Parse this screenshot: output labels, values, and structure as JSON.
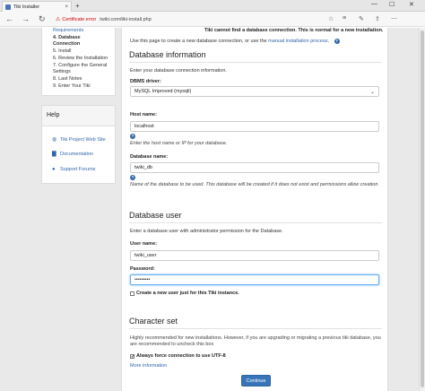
{
  "browser": {
    "tab_title": "Tiki Installer",
    "tab_close": "×",
    "new_tab": "+",
    "win_min": "—",
    "win_max": "☐",
    "win_close": "✕",
    "back_icon": "←",
    "forward_icon": "→",
    "refresh_icon": "↻",
    "cert_label": "Certificate error",
    "url": "twiki.com/tiki-install.php",
    "tools": [
      "☆",
      "≡",
      "✎",
      "⇪",
      "⋯"
    ]
  },
  "sidebar": {
    "steps": [
      {
        "text": "Requirements",
        "style": "link"
      },
      {
        "text": "4.  Database",
        "style": "bold"
      },
      {
        "text": "     Connection",
        "style": "bold"
      },
      {
        "text": "5.  Install",
        "style": ""
      },
      {
        "text": "6.  Review the Installation",
        "style": ""
      },
      {
        "text": "7.  Configure the General",
        "style": ""
      },
      {
        "text": "     Settings",
        "style": ""
      },
      {
        "text": "8.  Last Notes",
        "style": ""
      },
      {
        "text": "9.  Enter Your Tiki",
        "style": ""
      }
    ],
    "help_title": "Help",
    "help_links": [
      "Tiki Project Web Site",
      "Documentation",
      "Support Forums"
    ]
  },
  "main": {
    "warning": "Tiki cannot find a database connection. This is normal for a new installation.",
    "intro_before": "Use this page to create a new database connection, or use the ",
    "intro_link": "manual installation process",
    "intro_after": ".",
    "help_q": "?",
    "db_info": {
      "title": "Database information",
      "desc": "Enter your database connection information.",
      "driver_label": "DBMS driver:",
      "driver_value": "MySQL Improved (mysqli)",
      "host_label": "Host name:",
      "host_value": "localhost",
      "host_hint": "Enter the host name or IP for your database.",
      "dbname_label": "Database name:",
      "dbname_value": "twiki_db",
      "dbname_hint": "Name of the database to be used. This database will be created if it does not exist and permissions allow creation."
    },
    "db_user": {
      "title": "Database user",
      "desc": "Enter a database user with administrator permission for the Database.",
      "user_label": "User name:",
      "user_value": "twiki_user",
      "pass_label": "Password:",
      "pass_value": "•••••••••",
      "create_user_label": "Create a new user just for this Tiki instance."
    },
    "charset": {
      "title": "Character set",
      "desc": "Highly recommended for new installations. However, if you are upgrading or migrating a previous tiki database, you are recommended to uncheck this box",
      "force_utf8_label": "Always force connection to use UTF-8",
      "force_utf8_checked": "✓",
      "more_info": "More information"
    },
    "continue_label": "Continue"
  }
}
